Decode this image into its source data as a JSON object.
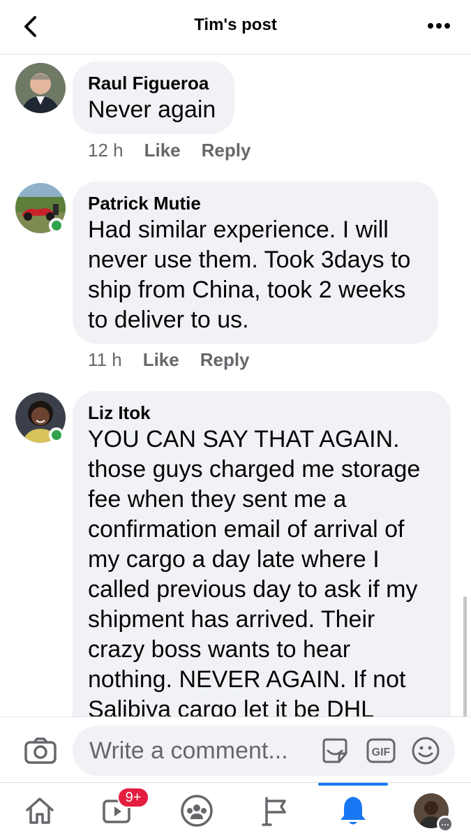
{
  "header": {
    "title": "Tim's post"
  },
  "comments": [
    {
      "author": "Raul Figueroa",
      "text": "Never again",
      "time": "12 h",
      "like": "Like",
      "reply": "Reply",
      "online": false
    },
    {
      "author": "Patrick Mutie",
      "text": "Had similar experience. I will never use them. Took 3days to ship from China, took 2 weeks to deliver to us.",
      "time": "11 h",
      "like": "Like",
      "reply": "Reply",
      "online": true
    },
    {
      "author": "Liz Itok",
      "text": "YOU CAN SAY THAT AGAIN. those guys charged me storage fee when they sent me a confirmation email of arrival of my cargo a day late where I called previous day to ask if my shipment has arrived. Their crazy boss wants to hear nothing. NEVER AGAIN. If not Salibiya cargo let it be DHL",
      "online": true
    }
  ],
  "composer": {
    "placeholder": "Write a comment...",
    "gif_label": "GIF"
  },
  "tabbar": {
    "items": [
      {
        "name": "home",
        "icon": "home-icon"
      },
      {
        "name": "watch",
        "icon": "video-icon",
        "badge": "9+"
      },
      {
        "name": "groups",
        "icon": "groups-icon"
      },
      {
        "name": "pages",
        "icon": "flag-icon"
      },
      {
        "name": "notifications",
        "icon": "bell-icon",
        "active": true
      },
      {
        "name": "menu",
        "icon": "avatar"
      }
    ]
  },
  "colors": {
    "accent": "#1877f2",
    "bubble": "#f0f2f5",
    "online": "#31a24c",
    "badge": "#e41e3f",
    "meta": "#65676b"
  }
}
